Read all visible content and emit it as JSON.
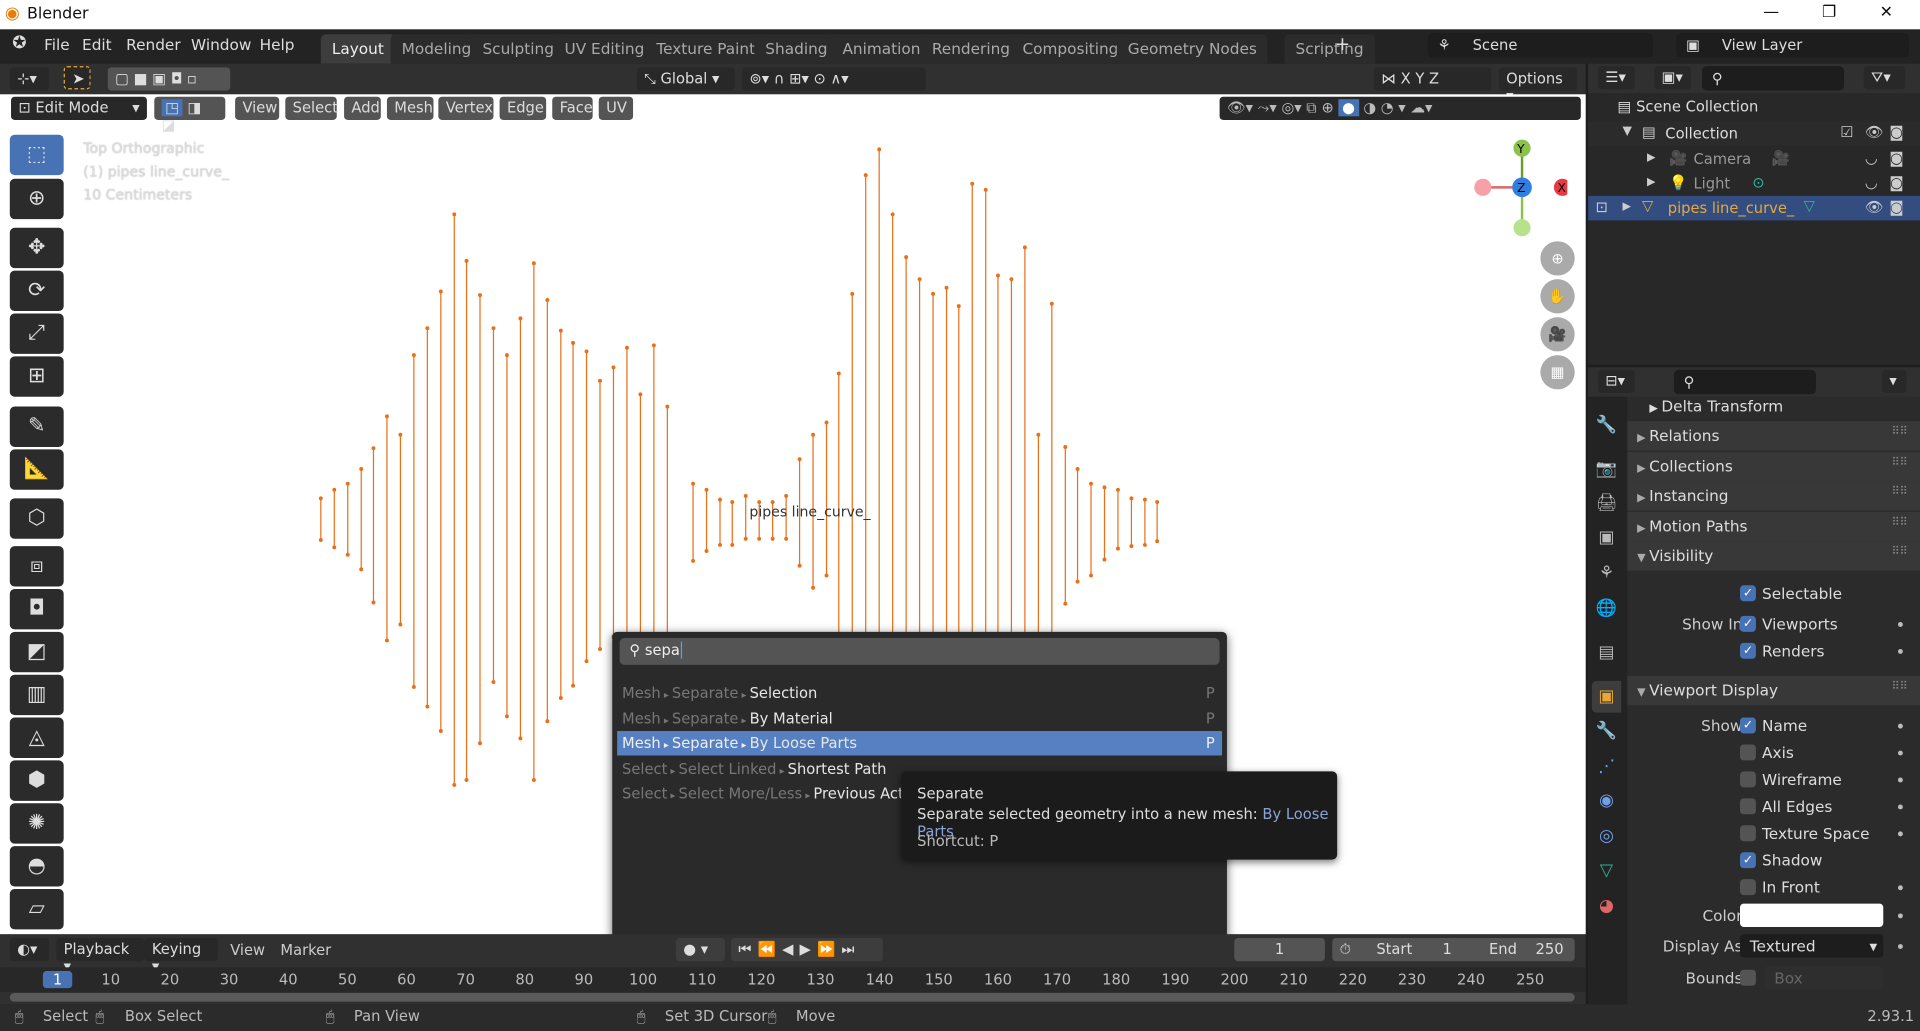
{
  "window": {
    "title": "Blender",
    "min": "—",
    "max": "❐",
    "close": "✕"
  },
  "menu": [
    "File",
    "Edit",
    "Render",
    "Window",
    "Help"
  ],
  "workspaces": [
    "Layout",
    "Modeling",
    "Sculpting",
    "UV Editing",
    "Texture Paint",
    "Shading",
    "Animation",
    "Rendering",
    "Compositing",
    "Geometry Nodes",
    "Scripting"
  ],
  "workspace_active": "Layout",
  "add_workspace": "+",
  "scene": {
    "name": "Scene",
    "view_layer": "View Layer"
  },
  "viewport_header": {
    "transform": "Global",
    "options": "Options",
    "axes": [
      "X",
      "Y",
      "Z"
    ]
  },
  "edit_header": {
    "mode": "Edit Mode",
    "menus": [
      "View",
      "Select",
      "Add",
      "Mesh",
      "Vertex",
      "Edge",
      "Face",
      "UV"
    ]
  },
  "overlay": {
    "view": "Top Orthographic",
    "object": "(1) pipes line_curve_",
    "scale": "10 Centimeters",
    "object_label": "pipes line_curve_"
  },
  "gizmo": {
    "y": "Y",
    "z": "Z",
    "x": "X"
  },
  "colors": {
    "accent": "#4772b3",
    "edge": "#e8701a",
    "selected_text": "#e8a838",
    "highlight": "#5680c2"
  },
  "search": {
    "query": "sepa",
    "items": [
      {
        "path": [
          "Mesh",
          "Separate"
        ],
        "name": "Selection",
        "shortcut": "P"
      },
      {
        "path": [
          "Mesh",
          "Separate"
        ],
        "name": "By Material",
        "shortcut": "P"
      },
      {
        "path": [
          "Mesh",
          "Separate"
        ],
        "name": "By Loose Parts",
        "shortcut": "P",
        "highlighted": true
      },
      {
        "path": [
          "Select",
          "Select Linked"
        ],
        "name": "Shortest Path",
        "shortcut": ""
      },
      {
        "path": [
          "Select",
          "Select More/Less"
        ],
        "name": "Previous Active",
        "shortcut": ""
      }
    ]
  },
  "tooltip": {
    "title": "Separate",
    "desc": "Separate selected geometry into a new mesh:",
    "value": "By Loose Parts",
    "shortcut": "Shortcut: P"
  },
  "outliner": {
    "root": "Scene Collection",
    "items": [
      {
        "name": "Collection",
        "level": 1
      },
      {
        "name": "Camera",
        "level": 2
      },
      {
        "name": "Light",
        "level": 2
      },
      {
        "name": "pipes line_curve_",
        "level": 1,
        "selected": true
      }
    ]
  },
  "properties": {
    "delta": "Delta Transform",
    "panels": [
      "Relations",
      "Collections",
      "Instancing",
      "Motion Paths",
      "Visibility"
    ],
    "visibility": {
      "selectable": "Selectable",
      "show_in": "Show In",
      "viewports": "Viewports",
      "renders": "Renders"
    },
    "viewport_display": {
      "title": "Viewport Display",
      "show": "Show",
      "checks": [
        {
          "label": "Name",
          "on": true
        },
        {
          "label": "Axis",
          "on": false
        },
        {
          "label": "Wireframe",
          "on": false
        },
        {
          "label": "All Edges",
          "on": false
        },
        {
          "label": "Texture Space",
          "on": false
        },
        {
          "label": "Shadow",
          "on": true
        },
        {
          "label": "In Front",
          "on": false
        }
      ],
      "color_label": "Color",
      "color": "#ffffff",
      "display_as_label": "Display As",
      "display_as": "Textured",
      "bounds_label": "Bounds",
      "bounds": "Box"
    }
  },
  "timeline": {
    "menus": [
      "Playback",
      "Keying",
      "View",
      "Marker"
    ],
    "current": "1",
    "start_label": "Start",
    "start": "1",
    "end_label": "End",
    "end": "250",
    "ticks": [
      "1",
      "10",
      "20",
      "30",
      "40",
      "50",
      "60",
      "70",
      "80",
      "90",
      "100",
      "110",
      "120",
      "130",
      "140",
      "150",
      "160",
      "170",
      "180",
      "190",
      "200",
      "210",
      "220",
      "230",
      "240",
      "250"
    ]
  },
  "status": {
    "select": "Select",
    "box_select": "Box Select",
    "pan": "Pan View",
    "cursor": "Set 3D Cursor",
    "move": "Move",
    "version": "2.93.1"
  }
}
